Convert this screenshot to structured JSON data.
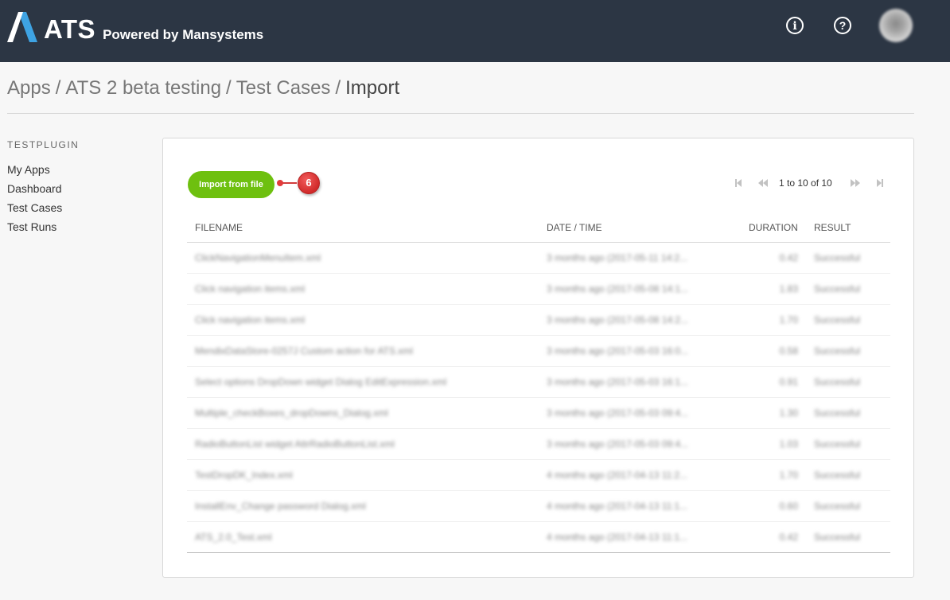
{
  "header": {
    "logo_text": "ATS",
    "logo_subtitle": "Powered by Mansystems",
    "info_icon": "info-icon",
    "help_icon": "help-icon",
    "info_glyph": "i",
    "help_glyph": "?"
  },
  "breadcrumb": {
    "items": [
      "Apps",
      "ATS 2 beta testing",
      "Test Cases"
    ],
    "separator": "/",
    "current": "Import"
  },
  "sidebar": {
    "title": "TESTPLUGIN",
    "items": [
      {
        "label": "My Apps"
      },
      {
        "label": "Dashboard"
      },
      {
        "label": "Test Cases"
      },
      {
        "label": "Test Runs"
      }
    ]
  },
  "toolbar": {
    "import_label": "Import from file",
    "marker_label": "6",
    "accent_color": "#6ec00f"
  },
  "pager": {
    "text": "1 to 10 of 10",
    "first_icon": "first-page-icon",
    "prev_icon": "previous-page-icon",
    "next_icon": "next-page-icon",
    "last_icon": "last-page-icon"
  },
  "table": {
    "headers": {
      "filename": "FILENAME",
      "datetime": "DATE / TIME",
      "duration": "DURATION",
      "result": "RESULT"
    },
    "rows": [
      {
        "filename": "ClickNavigationMenuItem.xml",
        "datetime": "3 months ago (2017-05-11 14:2...",
        "duration": "0.42",
        "result": "Successful"
      },
      {
        "filename": "Click navigation items.xml",
        "datetime": "3 months ago (2017-05-08 14:1...",
        "duration": "1.83",
        "result": "Successful"
      },
      {
        "filename": "Click navigation items.xml",
        "datetime": "3 months ago (2017-05-08 14:2...",
        "duration": "1.70",
        "result": "Successful"
      },
      {
        "filename": "MendixDataStore-0257J Custom action for ATS.xml",
        "datetime": "3 months ago (2017-05-03 16:0...",
        "duration": "0.58",
        "result": "Successful"
      },
      {
        "filename": "Select options DropDown widget Dialog EditExpression.xml",
        "datetime": "3 months ago (2017-05-03 16:1...",
        "duration": "0.91",
        "result": "Successful"
      },
      {
        "filename": "Multiple_checkBoxes_dropDowns_Dialog.xml",
        "datetime": "3 months ago (2017-05-03 09:4...",
        "duration": "1.30",
        "result": "Successful"
      },
      {
        "filename": "RadioButtonList widget AttrRadioButtonList.xml",
        "datetime": "3 months ago (2017-05-03 09:4...",
        "duration": "1.03",
        "result": "Successful"
      },
      {
        "filename": "TestDropDK_Index.xml",
        "datetime": "4 months ago (2017-04-13 11:2...",
        "duration": "1.70",
        "result": "Successful"
      },
      {
        "filename": "InstallEnv_Change password Dialog.xml",
        "datetime": "4 months ago (2017-04-13 11:1...",
        "duration": "0.60",
        "result": "Successful"
      },
      {
        "filename": "ATS_2.0_Test.xml",
        "datetime": "4 months ago (2017-04-13 11:1...",
        "duration": "0.42",
        "result": "Successful"
      }
    ]
  }
}
